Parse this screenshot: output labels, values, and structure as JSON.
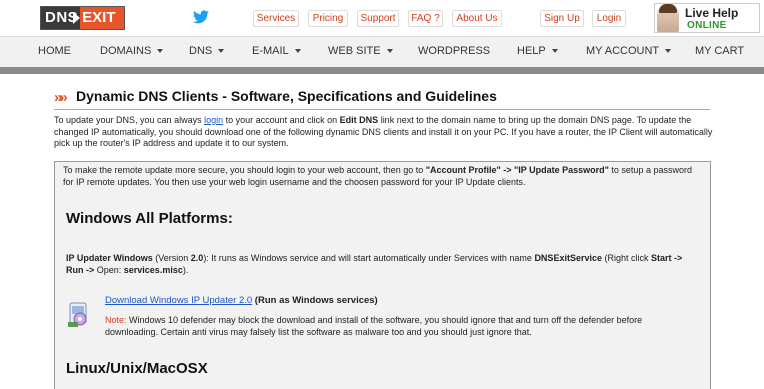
{
  "header": {
    "logo_left": "DNS",
    "logo_right": "EXIT",
    "links": [
      "Services",
      "Pricing",
      "Support",
      "FAQ ?",
      "About Us",
      "Sign Up",
      "Login"
    ],
    "live_help_title": "Live Help",
    "live_help_status": "ONLINE"
  },
  "nav": {
    "items": [
      "HOME",
      "DOMAINS",
      "DNS",
      "E-MAIL",
      "WEB SITE",
      "WORDPRESS",
      "HELP",
      "MY ACCOUNT",
      "MY CART"
    ]
  },
  "page": {
    "title": "Dynamic DNS Clients - Software, Specifications and Guidelines",
    "intro_1": "To update your DNS, you can always ",
    "intro_link": "login",
    "intro_2": " to your account and click on ",
    "intro_bold": "Edit DNS",
    "intro_3": " link next to the domain name to bring up the domain DNS page. To update the changed IP automatically, you should download one of the following dynamic DNS clients and install it on your PC. If you have a router, the IP Client will automatically pick up the router's IP address and update it to our system.",
    "box_note_1": "To make the remote update more secure, you should login to your web account, then go to ",
    "box_note_bold": "\"Account Profile\" -> \"IP Update Password\"",
    "box_note_2": " to setup a password for IP remote updates. You then use your web login username and the choosen password for your IP Update clients.",
    "windows_heading": "Windows All Platforms:",
    "win_name": "IP Updater Windows",
    "win_version": " (Version ",
    "win_version_num": "2.0",
    "win_desc_1": "): It runs as Windows service and will start automatically under Services with name ",
    "win_service": "DNSExitService",
    "win_desc_2": " (Right click ",
    "win_start": "Start -> Run ->",
    "win_desc_3": " Open: ",
    "win_msc": "services.misc",
    "win_desc_4": ").",
    "download_link": "Download Windows IP Updater 2.0",
    "download_suffix": " (Run as Windows services)",
    "note_label": "Note:",
    "note_text": " Windows 10 defender may block the download and install of the software, you should ignore that and turn off the defender before downloading. Certain anti virus may falsely list the software as malware too and you should just ignore that.",
    "linux_heading": "Linux/Unix/MacOSX"
  },
  "colors": {
    "accent": "#e8552a",
    "link": "#1a55c9",
    "online": "#2a9a2a"
  }
}
